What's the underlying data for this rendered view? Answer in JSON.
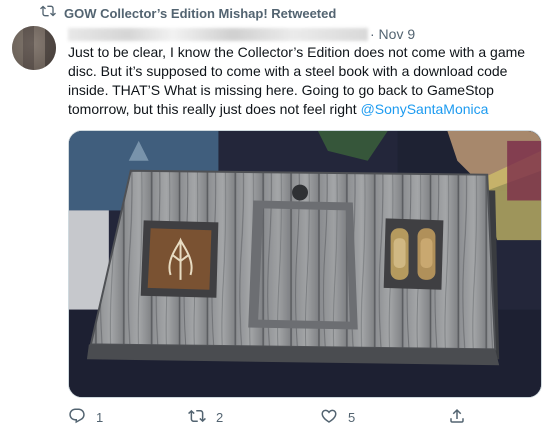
{
  "retweet_bar": {
    "label": "GOW Collector’s Edition Mishap! Retweeted",
    "icon": "retweet-icon"
  },
  "tweet": {
    "date": "· Nov 9",
    "lines": [
      "Just to be clear, I know the Collector’s Edition does not come with a game",
      "disc. But it’s supposed to come with a steel book with a download code",
      "inside. THAT’S What is missing here. Going to go back to GameStop",
      "tomorrow, but this really just does not feel right "
    ],
    "mention": "@SonySantaMonica"
  },
  "actions": {
    "reply_count": "1",
    "retweet_count": "2",
    "like_count": "5"
  },
  "colors": {
    "link": "#1d9bf0",
    "muted": "#536471",
    "text": "#0f1419"
  }
}
